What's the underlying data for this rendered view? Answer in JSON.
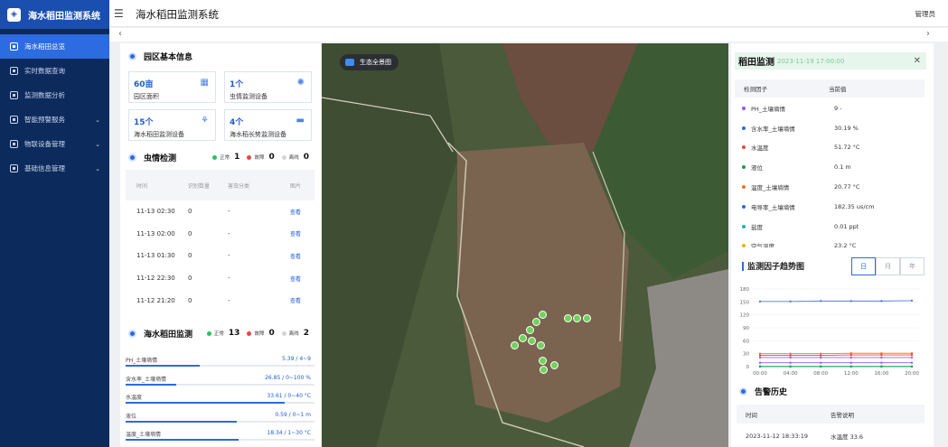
{
  "app": {
    "name": "海水稻田监测系统",
    "title": "海水稻田监测系统",
    "user": "管理员"
  },
  "menu": [
    {
      "label": "海水稻田总览",
      "active": true
    },
    {
      "label": "实时数据查询"
    },
    {
      "label": "监测数据分析"
    },
    {
      "label": "智能预警服务",
      "caret": "⌄"
    },
    {
      "label": "物联设备管理",
      "caret": "⌄"
    },
    {
      "label": "基础信息管理",
      "caret": "⌄"
    }
  ],
  "nav": {
    "prev": "‹",
    "next": "›"
  },
  "park": {
    "title": "园区基本信息",
    "cards": [
      {
        "value": "60亩",
        "label": "园区面积"
      },
      {
        "value": "1个",
        "label": "虫情监测设备"
      },
      {
        "value": "15个",
        "label": "海水稻田监测设备"
      },
      {
        "value": "4个",
        "label": "海水稻长势监测设备"
      }
    ]
  },
  "pest": {
    "title": "虫情检测",
    "normal_label": "正常",
    "normal": "1",
    "fault_label": "故障",
    "fault": "0",
    "offline_label": "离线",
    "offline": "0",
    "headers": [
      "时间",
      "识别数量",
      "害虫分类",
      "图片"
    ],
    "rows": [
      {
        "time": "11-13 02:30",
        "count": "0",
        "cat": "-",
        "link": "查看"
      },
      {
        "time": "11-13 02:00",
        "count": "0",
        "cat": "-",
        "link": "查看"
      },
      {
        "time": "11-13 01:30",
        "count": "0",
        "cat": "-",
        "link": "查看"
      },
      {
        "time": "11-12 22:30",
        "count": "0",
        "cat": "-",
        "link": "查看"
      },
      {
        "time": "11-12 21:20",
        "count": "0",
        "cat": "-",
        "link": "查看"
      }
    ]
  },
  "rice": {
    "title": "海水稻田监测",
    "normal_label": "正常",
    "normal": "13",
    "fault_label": "故障",
    "fault": "0",
    "offline_label": "离线",
    "offline": "2",
    "bars": [
      {
        "name": "PH_土壤墒情",
        "value": "5.39 / 4~9",
        "level": 0.39
      },
      {
        "name": "含水率_土壤墒情",
        "value": "26.85 / 0~100 %",
        "level": 0.27
      },
      {
        "name": "水温度",
        "value": "33.61 / 0~40 °C",
        "level": 0.84
      },
      {
        "name": "液位",
        "value": "0.59 / 0~1 m",
        "level": 0.59
      },
      {
        "name": "温度_土壤墒情",
        "value": "18.34 / 1~30 °C",
        "level": 0.6
      }
    ]
  },
  "map": {
    "button": "生态全景图"
  },
  "monitor": {
    "title": "稻田监测",
    "time": "2023-11-19 17:00:00",
    "close": "✕",
    "headers": [
      "检测因子",
      "当前值"
    ],
    "rows": [
      {
        "name": "PH_土壤墒情",
        "value": "9 -",
        "color": "#8b5cf6"
      },
      {
        "name": "含水率_土壤墒情",
        "value": "30.19 %",
        "color": "#2c6be0"
      },
      {
        "name": "水温度",
        "value": "51.72 °C",
        "color": "#ef4444"
      },
      {
        "name": "液位",
        "value": "0.1 m",
        "color": "#16a34a"
      },
      {
        "name": "温度_土壤墒情",
        "value": "20.77 °C",
        "color": "#f97316"
      },
      {
        "name": "电导率_土壤墒情",
        "value": "182.35 us/cm",
        "color": "#2c6be0"
      },
      {
        "name": "盐度",
        "value": "0.01 ppt",
        "color": "#14b8a6"
      },
      {
        "name": "空气温度",
        "value": "23.2 °C",
        "color": "#eab308"
      }
    ]
  },
  "trend": {
    "title": "监测因子趋势图",
    "tabs": [
      "日",
      "月",
      "年"
    ],
    "chart_data": {
      "type": "line",
      "x": [
        "00:00",
        "04:00",
        "08:00",
        "12:00",
        "16:00",
        "20:00"
      ],
      "ylim": [
        0,
        180
      ],
      "yticks": [
        0,
        30,
        60,
        90,
        120,
        150,
        180
      ],
      "series": [
        {
          "values": [
            151,
            151,
            152,
            152,
            152,
            153
          ],
          "color": "#5b7fd8"
        },
        {
          "values": [
            30,
            30,
            30,
            31,
            31,
            31
          ],
          "color": "#f97316"
        },
        {
          "values": [
            26,
            26,
            26,
            27,
            27,
            27
          ],
          "color": "#ef4444"
        },
        {
          "values": [
            21,
            21,
            21,
            21,
            21,
            21
          ],
          "color": "#a855f7"
        },
        {
          "values": [
            9,
            9,
            9,
            9,
            9,
            9
          ],
          "color": "#8b5cf6"
        },
        {
          "values": [
            0.5,
            0.5,
            0.5,
            0.5,
            0.5,
            0.5
          ],
          "color": "#14b8a6"
        },
        {
          "values": [
            0.1,
            0.1,
            0.1,
            0.1,
            0.1,
            0.1
          ],
          "color": "#16a34a"
        }
      ]
    }
  },
  "alarm": {
    "title": "告警历史",
    "headers": [
      "时间",
      "告警说明"
    ],
    "rows": [
      {
        "time": "2023-11-12 18:33:19",
        "desc": "水温度 33.6"
      }
    ]
  }
}
